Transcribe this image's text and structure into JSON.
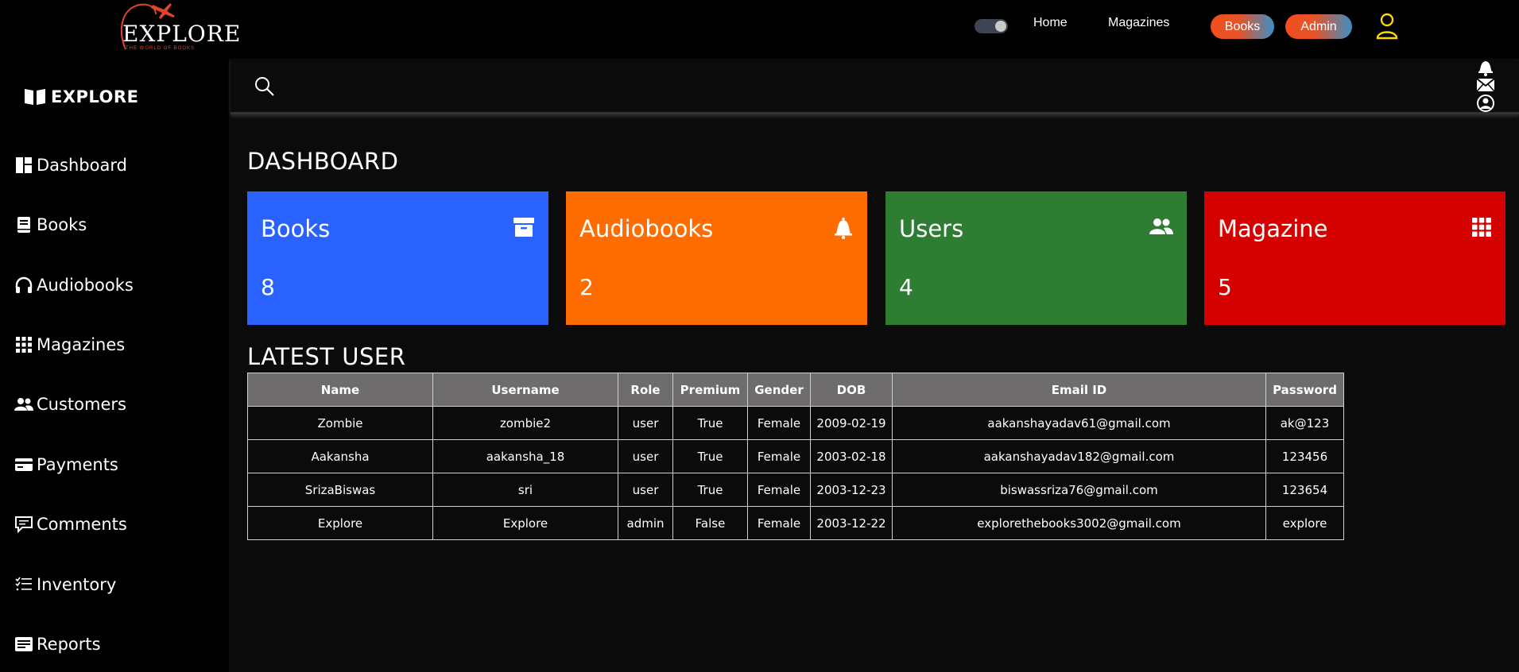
{
  "topbar": {
    "logo_text": "EXPLORE",
    "logo_subtitle": "THE WORLD OF BOOKS",
    "nav": [
      "Home",
      "Magazines"
    ],
    "books_button": "Books",
    "admin_button": "Admin"
  },
  "sidebar": {
    "brand": "EXPLORE",
    "items": [
      {
        "label": "Dashboard",
        "icon": "dashboard-icon"
      },
      {
        "label": "Books",
        "icon": "book-icon"
      },
      {
        "label": "Audiobooks",
        "icon": "headphones-icon"
      },
      {
        "label": "Magazines",
        "icon": "grid-icon"
      },
      {
        "label": "Customers",
        "icon": "users-icon"
      },
      {
        "label": "Payments",
        "icon": "card-icon"
      },
      {
        "label": "Comments",
        "icon": "comment-icon"
      },
      {
        "label": "Inventory",
        "icon": "list-icon"
      },
      {
        "label": "Reports",
        "icon": "report-icon"
      }
    ]
  },
  "main": {
    "title": "DASHBOARD",
    "cards": [
      {
        "title": "Books",
        "count": "8",
        "color": "#2962ff",
        "icon": "archive-icon"
      },
      {
        "title": "Audiobooks",
        "count": "2",
        "color": "#ff6d00",
        "icon": "bell-icon"
      },
      {
        "title": "Users",
        "count": "4",
        "color": "#2e7d32",
        "icon": "users-icon"
      },
      {
        "title": "Magazine",
        "count": "5",
        "color": "#d50000",
        "icon": "grid-icon"
      }
    ],
    "latest_title": "LATEST USER",
    "table": {
      "headers": [
        "Name",
        "Username",
        "Role",
        "Premium",
        "Gender",
        "DOB",
        "Email ID",
        "Password"
      ],
      "rows": [
        [
          "Zombie",
          "zombie2",
          "user",
          "True",
          "Female",
          "2009-02-19",
          "aakanshayadav61@gmail.com",
          "ak@123"
        ],
        [
          "Aakansha",
          "aakansha_18",
          "user",
          "True",
          "Female",
          "2003-02-18",
          "aakanshayadav182@gmail.com",
          "123456"
        ],
        [
          "SrizaBiswas",
          "sri",
          "user",
          "True",
          "Female",
          "2003-12-23",
          "biswassriza76@gmail.com",
          "123654"
        ],
        [
          "Explore",
          "Explore",
          "admin",
          "False",
          "Female",
          "2003-12-22",
          "explorethebooks3002@gmail.com",
          "explore"
        ]
      ]
    }
  },
  "colors": {
    "accent_orange": "#f24d1c",
    "accent_blue": "#3a8fc7",
    "user_icon": "#ffd600"
  }
}
